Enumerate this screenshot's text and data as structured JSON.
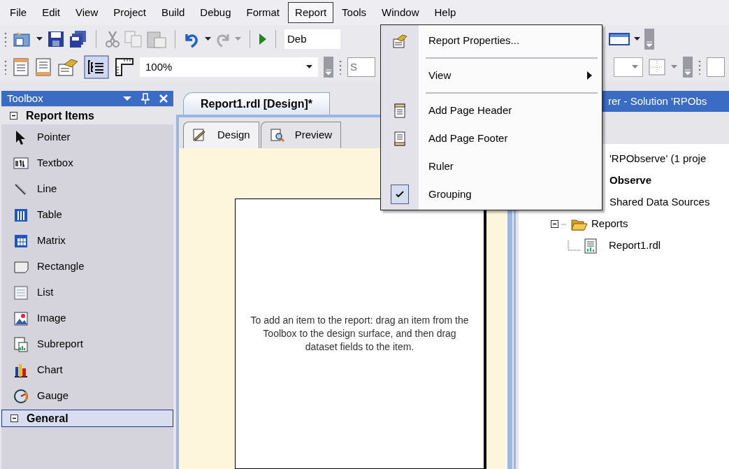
{
  "menubar": [
    {
      "label": "File",
      "selected": false
    },
    {
      "label": "Edit",
      "selected": false
    },
    {
      "label": "View",
      "selected": false
    },
    {
      "label": "Project",
      "selected": false
    },
    {
      "label": "Build",
      "selected": false
    },
    {
      "label": "Debug",
      "selected": false
    },
    {
      "label": "Format",
      "selected": false
    },
    {
      "label": "Report",
      "selected": true
    },
    {
      "label": "Tools",
      "selected": false
    },
    {
      "label": "Window",
      "selected": false
    },
    {
      "label": "Help",
      "selected": false
    }
  ],
  "toolbar_1": {
    "config_combo": "Deb"
  },
  "toolbar_2": {
    "zoom_combo": "100%",
    "style_combo": "S"
  },
  "report_menu": [
    {
      "kind": "item",
      "label": "Report Properties...",
      "checked": false
    },
    {
      "kind": "separator"
    },
    {
      "kind": "submenu",
      "label": "View",
      "checked": false
    },
    {
      "kind": "separator"
    },
    {
      "kind": "item",
      "label": "Add Page Header",
      "checked": false
    },
    {
      "kind": "item",
      "label": "Add Page Footer",
      "checked": false
    },
    {
      "kind": "item",
      "label": "Ruler",
      "checked": false
    },
    {
      "kind": "item",
      "label": "Grouping",
      "checked": true
    }
  ],
  "toolbox": {
    "title": "Toolbox",
    "groups": [
      {
        "label": "Report Items",
        "selected": false,
        "items": [
          "Pointer",
          "Textbox",
          "Line",
          "Table",
          "Matrix",
          "Rectangle",
          "List",
          "Image",
          "Subreport",
          "Chart",
          "Gauge"
        ]
      },
      {
        "label": "General",
        "selected": true
      }
    ]
  },
  "document": {
    "tab": "Report1.rdl [Design]*",
    "view_tabs": [
      {
        "label": "Design",
        "selected": true
      },
      {
        "label": "Preview",
        "selected": false
      }
    ],
    "hint": "To add an item to the report: drag an item from the Toolbox to the design surface, and then drag dataset fields to the item."
  },
  "solution_explorer": {
    "title": "rer - Solution 'RPObs",
    "tree": [
      {
        "text": "'RPObserve' (1 proje",
        "children": [
          {
            "text": "Observe",
            "children": [
              {
                "text": "Shared Data Sources"
              },
              {
                "text": "Reports",
                "children": [
                  {
                    "text": "Report1.rdl"
                  }
                ]
              }
            ]
          }
        ]
      }
    ]
  }
}
